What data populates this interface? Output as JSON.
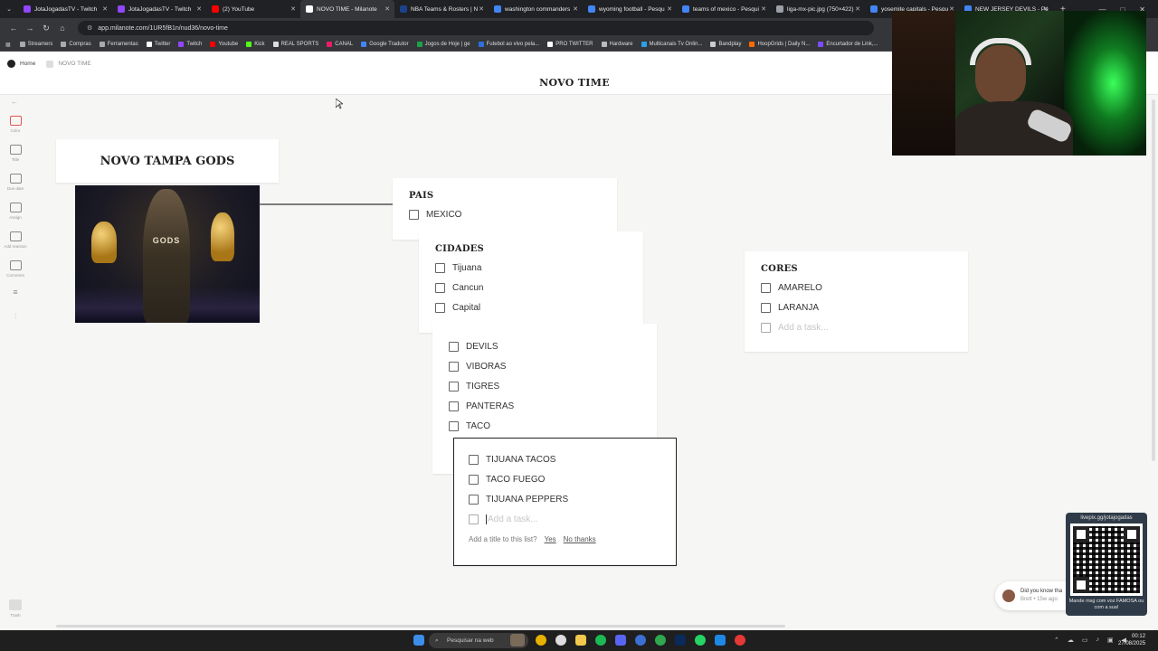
{
  "browser": {
    "tabs": [
      {
        "title": "JotaJogadasTV - Twitch",
        "color": "#9146ff"
      },
      {
        "title": "JotaJogadasTV - Twitch",
        "color": "#9146ff"
      },
      {
        "title": "(2) YouTube",
        "color": "#ff0000"
      },
      {
        "title": "NOVO TIME - Milanote",
        "color": "#ffffff",
        "active": true
      },
      {
        "title": "NBA Teams & Rosters | N",
        "color": "#1d428a"
      },
      {
        "title": "washington commanders",
        "color": "#4285f4"
      },
      {
        "title": "wyoming football - Pesqu",
        "color": "#4285f4"
      },
      {
        "title": "teams of mexico - Pesqui",
        "color": "#4285f4"
      },
      {
        "title": "liga-mx-pic.jpg (750×422)",
        "color": "#9aa0a6"
      },
      {
        "title": "yosemite capitals - Pesqu",
        "color": "#4285f4"
      },
      {
        "title": "NEW JERSEY DEVILS - Pe",
        "color": "#4285f4"
      }
    ],
    "url": "app.milanote.com/1UR5fB1n/nud36/novo-time",
    "bookmarks": [
      {
        "label": "Streamers",
        "color": "#aaa"
      },
      {
        "label": "Compras",
        "color": "#aaa"
      },
      {
        "label": "Ferramentas",
        "color": "#aaa"
      },
      {
        "label": "Twitter",
        "color": "#fff"
      },
      {
        "label": "Twitch",
        "color": "#9146ff"
      },
      {
        "label": "Youtube",
        "color": "#ff0000"
      },
      {
        "label": "Kick",
        "color": "#53fc18"
      },
      {
        "label": "REAL SPORTS",
        "color": "#ddd"
      },
      {
        "label": "CANAL",
        "color": "#e91e63"
      },
      {
        "label": "Google Tradutor",
        "color": "#4285f4"
      },
      {
        "label": "Jogos de Hoje | ge",
        "color": "#1aa34a"
      },
      {
        "label": "Futebol ao vivo pela...",
        "color": "#2f6fdb"
      },
      {
        "label": "PRO TWITTER",
        "color": "#fff"
      },
      {
        "label": "Hardware",
        "color": "#bbb"
      },
      {
        "label": "Multicanais Tv Onlin...",
        "color": "#2aa0e8"
      },
      {
        "label": "Bandplay",
        "color": "#ccc"
      },
      {
        "label": "HoopGrids | Daily N...",
        "color": "#ff6a00"
      },
      {
        "label": "Encurtador de Link,...",
        "color": "#7c4dff"
      }
    ]
  },
  "milanote": {
    "breadcrumb": {
      "home": "Home",
      "current": "NOVO TIME"
    },
    "board_title": "NOVO TIME",
    "toolbar": [
      {
        "label": "Color",
        "icon": "pen-icon"
      },
      {
        "label": "Title",
        "icon": "title-icon"
      },
      {
        "label": "Due date",
        "icon": "calendar-icon"
      },
      {
        "label": "Assign",
        "icon": "person-icon"
      },
      {
        "label": "Add reaction",
        "icon": "reaction-icon"
      },
      {
        "label": "Comment",
        "icon": "comment-icon"
      }
    ],
    "trash_label": "Trash",
    "team_card": {
      "title": "NOVO TAMPA GODS",
      "image_text": "GODS"
    },
    "pais": {
      "title": "PAIS",
      "tasks": [
        "MEXICO"
      ]
    },
    "cidades": {
      "title": "CIDADES",
      "tasks": [
        "Tijuana",
        "Cancun",
        "Capital"
      ]
    },
    "nomes": {
      "tasks": [
        "DEVILS",
        "VIBORAS",
        "TIGRES",
        "PANTERAS",
        "TACO"
      ]
    },
    "active_list": {
      "tasks": [
        "TIJUANA TACOS",
        "TACO FUEGO",
        "TIJUANA PEPPERS"
      ],
      "placeholder": "Add a task...",
      "prompt": "Add a title to this list?",
      "yes": "Yes",
      "no": "No thanks"
    },
    "cores": {
      "title": "CORES",
      "tasks": [
        "AMARELO",
        "LARANJA"
      ],
      "placeholder": "Add a task..."
    }
  },
  "notification": {
    "text": "Did you know tha",
    "sub": "Brett • 15w ago"
  },
  "overlay": {
    "qr_url": "livepix.gg/jotajogadas",
    "qr_caption": "Mande msg com voz FAMOSA ou com a sua!"
  },
  "taskbar": {
    "search_placeholder": "Pesquisar na web",
    "time": "00:12",
    "date": "27/08/2025"
  }
}
